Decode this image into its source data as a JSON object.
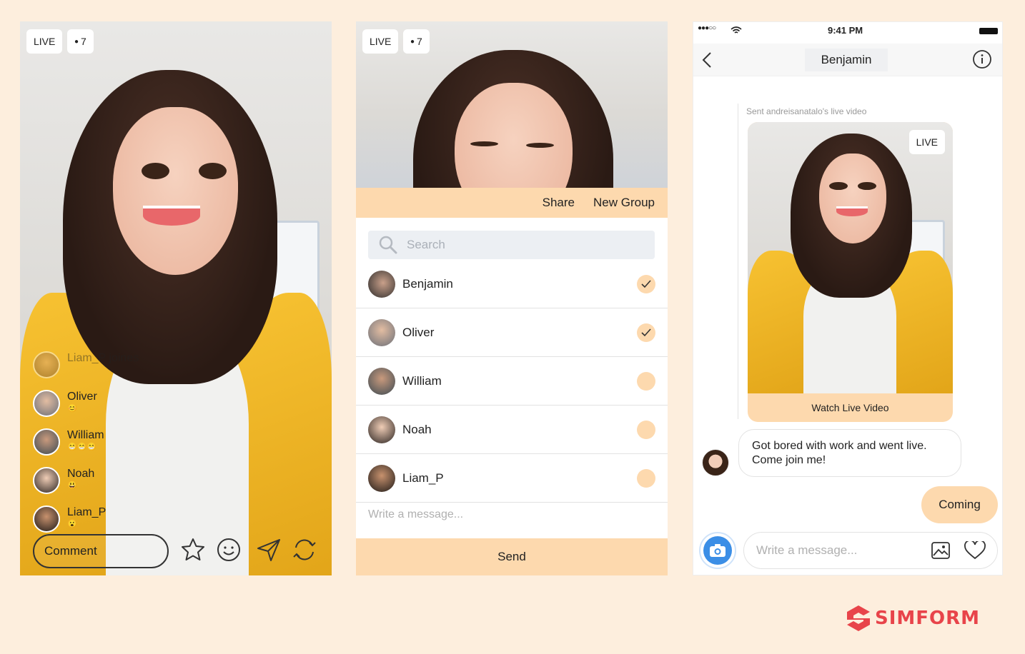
{
  "colors": {
    "background": "#fdeedd",
    "accent": "#fdd9ae",
    "brand": "#e8444a"
  },
  "live_screen": {
    "live_badge": "LIVE",
    "viewer_count": "7",
    "joiners": [
      {
        "name": "Liam_P joines",
        "emoji": "",
        "faded": true
      },
      {
        "name": "Oliver",
        "emoji": "😊"
      },
      {
        "name": "William",
        "emoji": "😁😁😁"
      },
      {
        "name": "Noah",
        "emoji": "😃"
      },
      {
        "name": "Liam_P",
        "emoji": "😮"
      }
    ],
    "comment_placeholder": "Comment",
    "icons": [
      "star-icon",
      "smiley-icon",
      "send-icon",
      "rotate-camera-icon"
    ]
  },
  "share_screen": {
    "live_badge": "LIVE",
    "viewer_count": "7",
    "share_label": "Share",
    "new_group_label": "New Group",
    "search_placeholder": "Search",
    "contacts": [
      {
        "name": "Benjamin",
        "checked": true
      },
      {
        "name": "Oliver",
        "checked": true
      },
      {
        "name": "William",
        "checked": false
      },
      {
        "name": "Noah",
        "checked": false
      },
      {
        "name": "Liam_P",
        "checked": false
      }
    ],
    "message_placeholder": "Write a message...",
    "send_label": "Send"
  },
  "chat_screen": {
    "status_time": "9:41 PM",
    "contact_name": "Benjamin",
    "sent_note": "Sent andreisanatalo's live video",
    "video_live_badge": "LIVE",
    "watch_label": "Watch Live Video",
    "incoming_message": "Got bored with work and went live. Come join me!",
    "outgoing_message": "Coming",
    "input_placeholder": "Write a message..."
  },
  "brand": {
    "name": "SIMFORM"
  }
}
